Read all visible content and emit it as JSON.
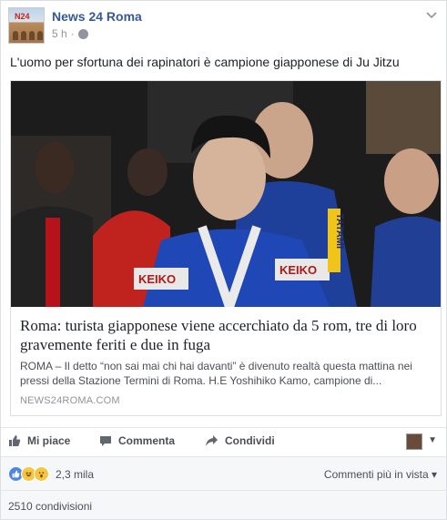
{
  "post": {
    "page_name": "News 24 Roma",
    "page_logo_text": "N24",
    "timestamp": "5 h",
    "separator": "·",
    "status_text": "L'uomo per sfortuna dei rapinatori è campione giapponese di Ju Jitzu",
    "menu_icon": "chevron-down-icon"
  },
  "link": {
    "title": "Roma: turista giapponese viene accerchiato da 5 rom, tre di loro gravemente feriti e due in fuga",
    "description": "ROMA – Il detto “non sai mai chi hai davanti” è divenuto realtà questa mattina nei pressi della Stazione Termini di Roma. H.E Yoshihiko Kamo, campione di...",
    "domain": "NEWS24ROMA.COM",
    "image_labels": [
      "KEIKO",
      "KEIKO",
      "TATAMI"
    ]
  },
  "actions": {
    "like_label": "Mi piace",
    "comment_label": "Commenta",
    "share_label": "Condividi"
  },
  "reactions": {
    "count": "2,3 mila",
    "types": [
      "like",
      "haha",
      "wow"
    ],
    "comment_filter": "Commenti più in vista ▾"
  },
  "shares": {
    "label": "2510 condivisioni"
  },
  "colors": {
    "link_blue": "#365899",
    "meta_gray": "#90949c",
    "like_blue": "#4e86e4"
  }
}
